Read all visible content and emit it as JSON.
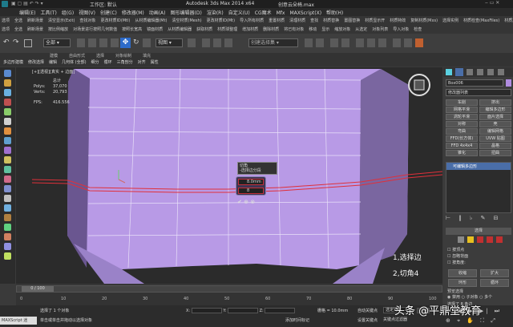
{
  "window": {
    "quick_access": "工作区: 默认",
    "title": "Autodesk 3ds Max  2014 x64",
    "filename": "创意云朵椅.max"
  },
  "menu": [
    "编辑(E)",
    "工具(T)",
    "组(G)",
    "视图(V)",
    "创建(C)",
    "修改器(M)",
    "动画(A)",
    "图形编辑器(D)",
    "渲染(R)",
    "自定义(U)",
    "CG魔术",
    "Mfx",
    "MAXScript(X)",
    "帮助(H)"
  ],
  "plugin_bar_row1": [
    "选项",
    "全选",
    "刷新场景",
    "清空显示(Exit)",
    "查找对象",
    "更改材质ID(Mtl)",
    "从材质编辑器(Mt)",
    "清空材质(Mesh)",
    "更改材质ID(Mt)",
    "导入所有材质",
    "重置材质",
    "清理材质",
    "查找",
    "材质替换",
    "置图替换",
    "材质显示开",
    "材质特效",
    "复制材质(Mxs)",
    "选择实例",
    "材质检查(MaxFiles)",
    "材质加密",
    "转换材质",
    "MAX版本检查"
  ],
  "plugin_bar_row2": [
    "选项",
    "全选",
    "刷新场景",
    "按比例缩放",
    "对场景进行按照几何数值",
    "按照长宽高",
    "镜面材质",
    "从材质编辑器",
    "获取材质",
    "材质球整理",
    "增加材质",
    "删除材质",
    "将已有对象",
    "移动",
    "显示",
    "缩放对象",
    "从选定",
    "对象列表",
    "导入对象",
    "检查"
  ],
  "toolbar": {
    "selection_filter": "全部",
    "ref_coord": "视图",
    "named_sel": "创建选择集"
  },
  "ribbon": {
    "tabs": [
      "建模",
      "自由形式",
      "选择",
      "对象绘制",
      "填充"
    ],
    "row2": [
      "多边形建模",
      "修改选择",
      "编辑",
      "几何体 (全部)",
      "细分",
      "循环",
      "三角剖分",
      "对齐",
      "属性"
    ]
  },
  "viewport": {
    "label": "[+][透视][真实 + 边面]",
    "stats_label_total": "总计",
    "stats_polys_label": "Polys:",
    "stats_polys": "37,070",
    "stats_verts_label": "Verts:",
    "stats_verts": "20,793",
    "fps_label": "FPS:",
    "fps": "416.556",
    "caddy_title": "切角",
    "caddy_sub": "-选择边分段",
    "chamfer_amount": "8.0mm",
    "chamfer_segments": "8",
    "annotation1": "1,选择边",
    "annotation2": "2,切角4"
  },
  "command_panel": {
    "object_name": "Box006",
    "modifier_list": "修改器列表",
    "buttons": [
      "车削",
      "挤出",
      "网格平滑",
      "编辑多边形",
      "涡轮平滑",
      "面片选择",
      "对称",
      "壳",
      "弯曲",
      "编辑网格",
      "FFD(长方体)",
      "UVW 贴图",
      "FFD 4x4x4",
      "晶格",
      "锥化",
      "扭曲"
    ],
    "stack_item": "可编辑多边形",
    "rollout_select": "选择",
    "by_vertex": "按顶点",
    "ignore_back": "忽略背面",
    "by_angle": "按角度:",
    "shrink": "收缩",
    "grow": "扩大",
    "ring": "环形",
    "loop": "循环",
    "preview_selection": "预览选择",
    "disable": "禁用",
    "subobj": "子对象",
    "multi": "多个",
    "selected_count": "选择了 8 条边"
  },
  "timeline": {
    "frame": "0 / 100",
    "ticks": [
      "0",
      "10",
      "20",
      "30",
      "40",
      "50",
      "60",
      "70",
      "80",
      "90",
      "100"
    ]
  },
  "status": {
    "maxscript": "MAXScript 迷",
    "selected": "选择了 1 个对象",
    "prompt": "单击或单击并拖动以选择对象",
    "x_label": "X:",
    "y_label": "Y:",
    "z_label": "Z:",
    "grid": "栅格 = 10.0mm",
    "add_time_tag": "添加时间标记",
    "auto_key": "自动关键点",
    "set_key": "设置关键点",
    "selected_obj": "选定对象",
    "key_filter": "关键点过滤器"
  },
  "watermark": "头条 @平鼎堂教育",
  "colors": {
    "object_fill": "#b89ae6",
    "object_dark": "#6a5690",
    "selected_edge": "#e0303a",
    "cmd_active": "#4a6ea8"
  }
}
